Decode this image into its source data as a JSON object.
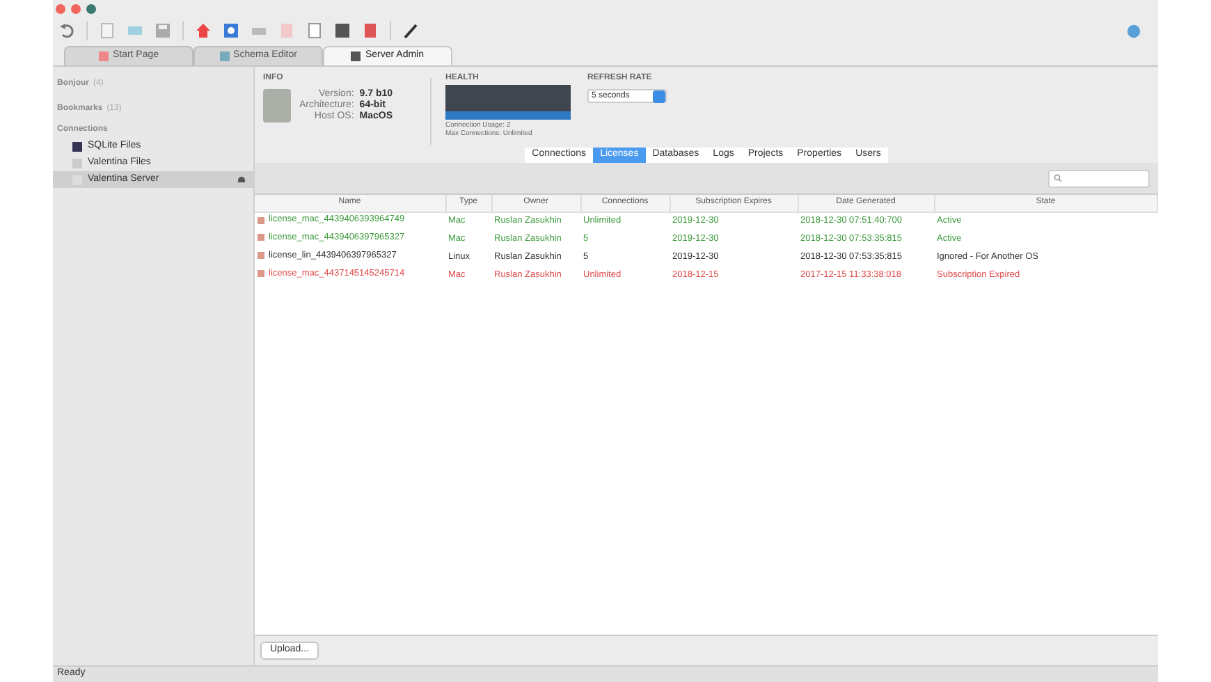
{
  "tabs": [
    {
      "label": "Start Page",
      "selected": false
    },
    {
      "label": "Schema Editor",
      "selected": false
    },
    {
      "label": "Server Admin",
      "selected": true
    }
  ],
  "sidebar": {
    "groups": [
      {
        "label": "Bonjour",
        "count": "(4)"
      },
      {
        "label": "Bookmarks",
        "count": "(13)"
      }
    ],
    "connections_label": "Connections",
    "items": [
      {
        "label": "SQLite Files",
        "selected": false
      },
      {
        "label": "Valentina Files",
        "selected": false
      },
      {
        "label": "Valentina Server",
        "selected": true
      }
    ]
  },
  "info": {
    "title": "INFO",
    "fields": [
      {
        "label": "Version:",
        "value": "9.7 b10"
      },
      {
        "label": "Architecture:",
        "value": "64-bit"
      },
      {
        "label": "Host OS:",
        "value": "MacOS"
      }
    ]
  },
  "health": {
    "title": "HEALTH",
    "lines": [
      "Connection Usage: 2",
      "Max Connections: Unlimited"
    ]
  },
  "refresh_rate": {
    "title": "REFRESH RATE",
    "value": "5 seconds"
  },
  "subtabs": [
    {
      "label": "Connections",
      "selected": false
    },
    {
      "label": "Licenses",
      "selected": true
    },
    {
      "label": "Databases",
      "selected": false
    },
    {
      "label": "Logs",
      "selected": false
    },
    {
      "label": "Projects",
      "selected": false
    },
    {
      "label": "Properties",
      "selected": false
    },
    {
      "label": "Users",
      "selected": false
    }
  ],
  "table": {
    "columns": [
      "Name",
      "Type",
      "Owner",
      "Connections",
      "Subscription Expires",
      "Date Generated",
      "State"
    ],
    "rows": [
      {
        "color": "#3c9a3c",
        "cells": [
          "license_mac_4439406393964749",
          "Mac",
          "Ruslan Zasukhin",
          "Unlimited",
          "2019-12-30",
          "2018-12-30 07:51:40:700",
          "Active"
        ]
      },
      {
        "color": "#3c9a3c",
        "cells": [
          "license_mac_4439406397965327",
          "Mac",
          "Ruslan Zasukhin",
          "5",
          "2019-12-30",
          "2018-12-30 07:53:35:815",
          "Active"
        ]
      },
      {
        "color": "#333333",
        "cells": [
          "license_lin_4439406397965327",
          "Linux",
          "Ruslan Zasukhin",
          "5",
          "2019-12-30",
          "2018-12-30 07:53:35:815",
          "Ignored - For Another OS"
        ]
      },
      {
        "color": "#e04848",
        "cells": [
          "license_mac_4437145145245714",
          "Mac",
          "Ruslan Zasukhin",
          "Unlimited",
          "2018-12-15",
          "2017-12-15 11:33:38:018",
          "Subscription Expired"
        ]
      }
    ]
  },
  "upload_button": "Upload...",
  "status_bar": "Ready"
}
